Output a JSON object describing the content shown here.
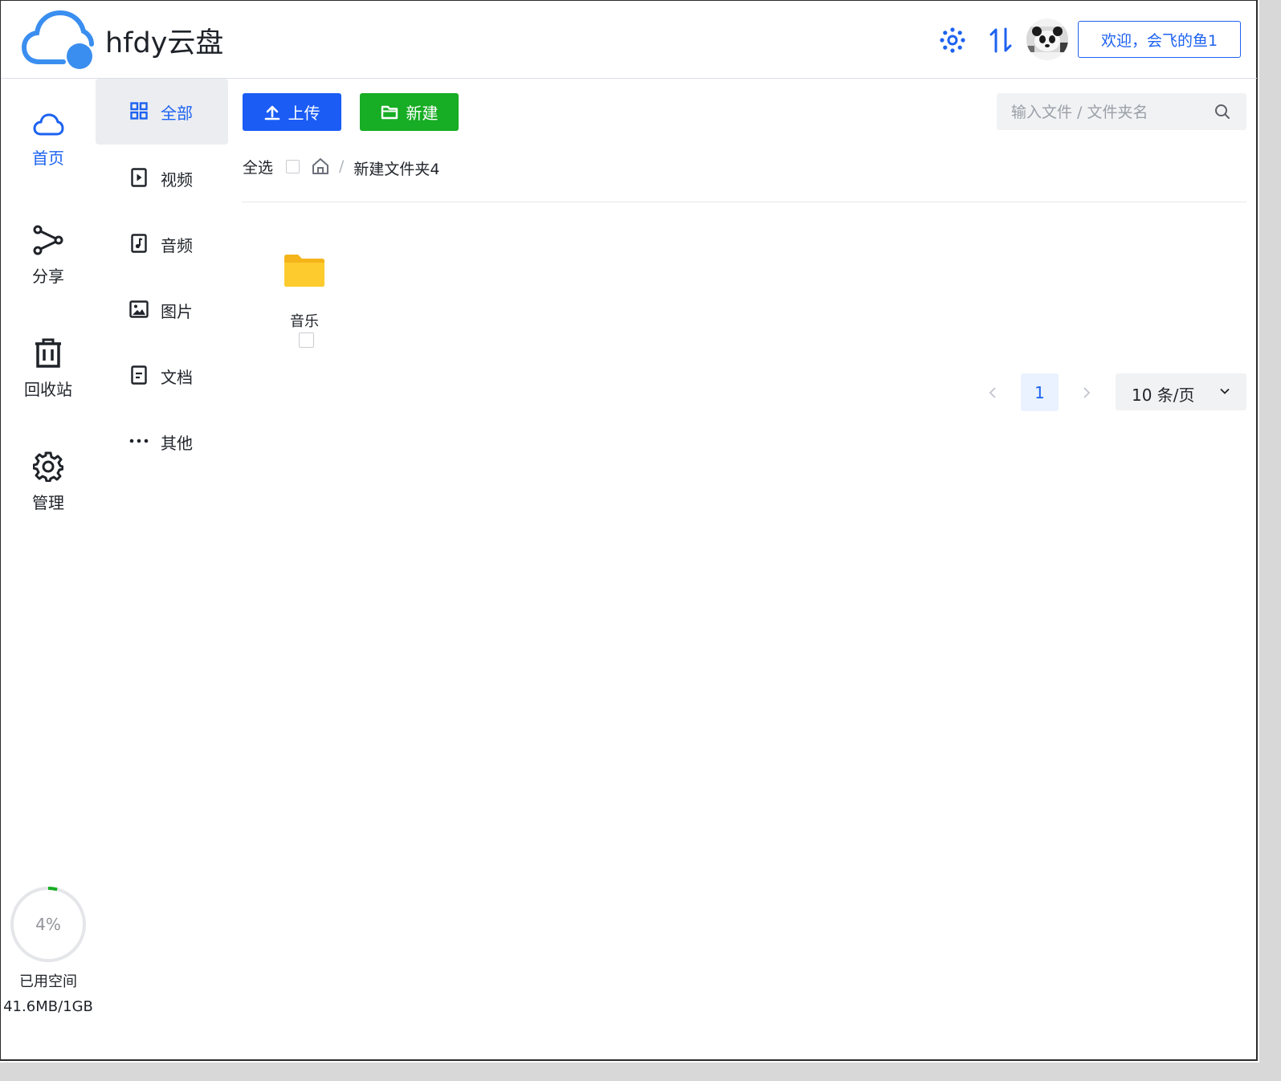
{
  "app": {
    "title": "hfdy云盘"
  },
  "header": {
    "settings_icon": "gear-icon",
    "transfer_icon": "transfer-icon",
    "avatar_alt": "panda avatar",
    "welcome_text": "欢迎，会飞的鱼1"
  },
  "nav": {
    "items": [
      {
        "label": "首页",
        "icon": "cloud-icon",
        "active": true
      },
      {
        "label": "分享",
        "icon": "share-icon",
        "active": false
      },
      {
        "label": "回收站",
        "icon": "trash-icon",
        "active": false
      },
      {
        "label": "管理",
        "icon": "gear-icon",
        "active": false
      }
    ]
  },
  "categories": [
    {
      "label": "全部",
      "icon": "grid-icon",
      "active": true
    },
    {
      "label": "视频",
      "icon": "video-icon",
      "active": false
    },
    {
      "label": "音频",
      "icon": "audio-icon",
      "active": false
    },
    {
      "label": "图片",
      "icon": "image-icon",
      "active": false
    },
    {
      "label": "文档",
      "icon": "document-icon",
      "active": false
    },
    {
      "label": "其他",
      "icon": "more-icon",
      "active": false
    }
  ],
  "toolbar": {
    "upload_label": "上传",
    "new_label": "新建",
    "search_placeholder": "输入文件 / 文件夹名"
  },
  "breadcrumb": {
    "select_all_label": "全选",
    "separator": "/",
    "current_folder": "新建文件夹4"
  },
  "files": [
    {
      "name": "音乐",
      "type": "folder",
      "checked": false
    }
  ],
  "pagination": {
    "current_page": "1",
    "page_size_label": "10 条/页",
    "prev_icon": "chevron-left-icon",
    "next_icon": "chevron-right-icon"
  },
  "storage": {
    "percent_label": "4%",
    "percent_value": 0.04,
    "used_label": "已用空间",
    "usage_text": "41.6MB/1GB"
  },
  "colors": {
    "primary": "#1d62f0",
    "upload_button": "#1b5cf5",
    "new_button": "#17ad24",
    "folder": "#fcc82c",
    "storage_ring": "#17ad24"
  }
}
